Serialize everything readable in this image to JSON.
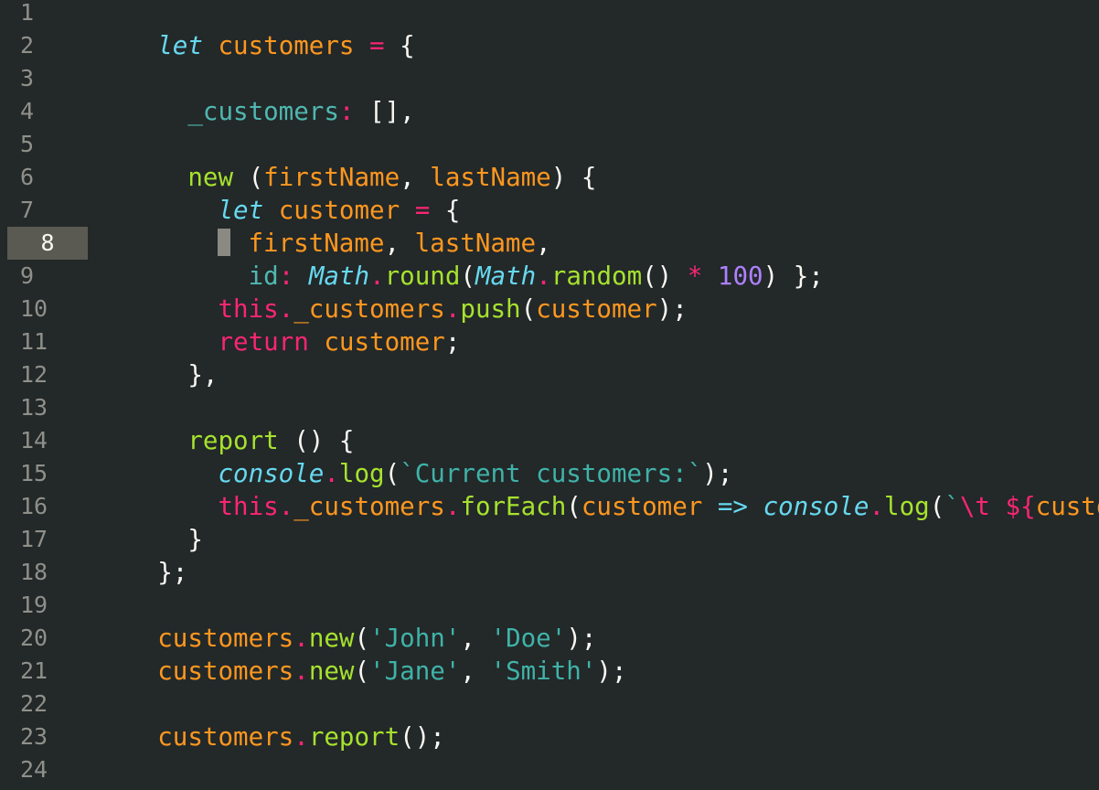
{
  "active_line": 8,
  "lines": [
    {
      "num": "1"
    },
    {
      "num": "2"
    },
    {
      "num": "3"
    },
    {
      "num": "4"
    },
    {
      "num": "5"
    },
    {
      "num": "6"
    },
    {
      "num": "7"
    },
    {
      "num": "8"
    },
    {
      "num": "9"
    },
    {
      "num": "10"
    },
    {
      "num": "11"
    },
    {
      "num": "12"
    },
    {
      "num": "13"
    },
    {
      "num": "14"
    },
    {
      "num": "15"
    },
    {
      "num": "16"
    },
    {
      "num": "17"
    },
    {
      "num": "18"
    },
    {
      "num": "19"
    },
    {
      "num": "20"
    },
    {
      "num": "21"
    },
    {
      "num": "22"
    },
    {
      "num": "23"
    },
    {
      "num": "24"
    }
  ],
  "code": {
    "l2": [
      "    ",
      "let",
      " ",
      "customers",
      " ",
      "=",
      " {"
    ],
    "l4": [
      "      ",
      "_customers",
      ":",
      " [],"
    ],
    "l6": [
      "      ",
      "new",
      " (",
      "firstName",
      ", ",
      "lastName",
      ") {"
    ],
    "l7": [
      "        ",
      "let",
      " ",
      "customer",
      " ",
      "=",
      " {"
    ],
    "l8": [
      "        ",
      "firstName",
      ", ",
      "lastName",
      ","
    ],
    "l9": [
      "          ",
      "id",
      ":",
      " ",
      "Math",
      ".",
      "round",
      "(",
      "Math",
      ".",
      "random",
      "() ",
      "*",
      " ",
      "100",
      ") };"
    ],
    "l10": [
      "        ",
      "this",
      ".",
      "_customers",
      ".",
      "push",
      "(",
      "customer",
      ");"
    ],
    "l11": [
      "        ",
      "return",
      " ",
      "customer",
      ";"
    ],
    "l12": [
      "      },"
    ],
    "l14": [
      "      ",
      "report",
      " () {"
    ],
    "l15": [
      "        ",
      "console",
      ".",
      "log",
      "(",
      "`Current customers:`",
      ");"
    ],
    "l16": [
      "        ",
      "this",
      ".",
      "_customers",
      ".",
      "forEach",
      "(",
      "customer",
      " ",
      "=>",
      " ",
      "console",
      ".",
      "log",
      "(",
      "`",
      "\\t",
      " ",
      "${",
      "custom"
    ],
    "l17": [
      "      }"
    ],
    "l18": [
      "    };"
    ],
    "l20": [
      "    ",
      "customers",
      ".",
      "new",
      "(",
      "'John'",
      ", ",
      "'Doe'",
      ");"
    ],
    "l21": [
      "    ",
      "customers",
      ".",
      "new",
      "(",
      "'Jane'",
      ", ",
      "'Smith'",
      ");"
    ],
    "l23": [
      "    ",
      "customers",
      ".",
      "report",
      "();"
    ]
  },
  "colors": {
    "background": "#232829",
    "keyword": "#66d9ef",
    "variable": "#fd971f",
    "operator": "#f92672",
    "function": "#a6e22e",
    "string": "#3fb3a8",
    "number": "#ae81ff"
  }
}
